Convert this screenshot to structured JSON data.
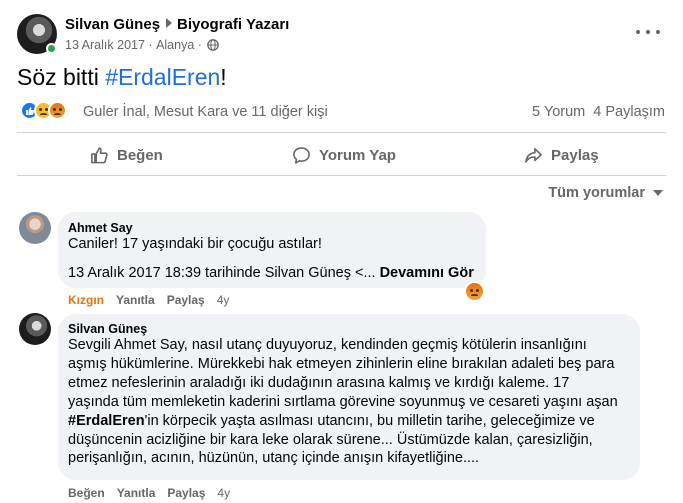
{
  "post": {
    "author": "Silvan Güneş",
    "subtitle": "Biyografi Yazarı",
    "date": "13 Aralık 2017",
    "location_sep": "·",
    "location": "Alanya",
    "location_sep2": "·",
    "text_prefix": "Söz bitti ",
    "hashtag": "#ErdalEren",
    "text_suffix": "!"
  },
  "stats": {
    "reaction_icons": [
      "like-icon",
      "sad-icon",
      "angry-icon"
    ],
    "reactors": "Guler İnal, Mesut Kara ve 11 diğer kişi",
    "comments": "5 Yorum",
    "shares": "4 Paylaşım"
  },
  "actions": {
    "like": "Beğen",
    "comment": "Yorum Yap",
    "share": "Paylaş"
  },
  "sort_label": "Tüm yorumlar",
  "comments": [
    {
      "author": "Ahmet Say",
      "text": "Caniler! 17 yaşındaki bir çocuğu astılar!",
      "quote": "13 Aralık 2017 18:39 tarihinde Silvan Güneş <...",
      "see_more": "Devamını Gör",
      "reaction_label": "Kızgın",
      "reply": "Yanıtla",
      "share": "Paylaş",
      "age": "4y"
    },
    {
      "author": "Silvan Güneş",
      "lines": [
        "Sevgili Ahmet Say, nasıl utanç duyuyoruz, kendinden geçmiş kötülerin insanlığını",
        "aşmış hükümlerine. Mürekkebi hak etmeyen zihinlerin eline bırakılan adaleti beş para",
        "etmez nefeslerinin araladığı iki dudağının arasına kalmış ve kırdığı kaleme. 17",
        "yaşında tüm memleketin kaderini sırtlama görevine soyunmuş ve cesareti yaşını aşan"
      ],
      "hashtag": "#ErdalEren",
      "line5_rest": "'in körpecik yaşta asılması utancını, bu milletin tarihe, geleceğimize ve",
      "lines_after": [
        "düşüncenin acizliğine bir kara leke olarak sürene... Üstümüzde kalan, çaresizliğin,",
        "perişanlığın, acının, hüzünün, utanç içinde anışın kifayetliğine...."
      ],
      "like": "Beğen",
      "reply": "Yanıtla",
      "share": "Paylaş",
      "age": "4y"
    }
  ],
  "colors": {
    "hashtag": "#216fdb",
    "secondary_text": "#65676b",
    "bubble": "#f0f2f5",
    "angry": "#e9710f",
    "like_blue": "#1877f2"
  }
}
